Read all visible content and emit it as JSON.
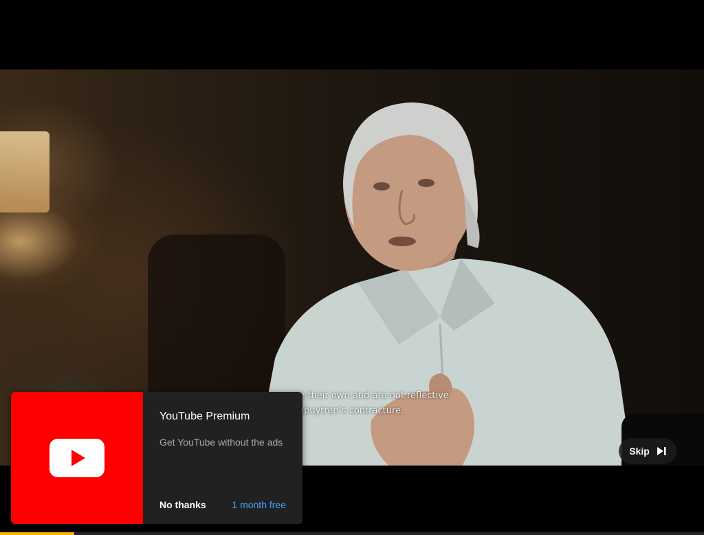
{
  "video": {
    "subtitle_lines": [
      "ences are their own and are not reflective",
      "e with Dupuytren’s contracture."
    ]
  },
  "ad": {
    "title": "YouTube Premium",
    "description": "Get YouTube without the ads",
    "decline_label": "No thanks",
    "accept_label": "1 month free",
    "logo_icon": "youtube-logo-icon",
    "thumb_color": "#ff0000",
    "accept_color": "#3ea6ff"
  },
  "skip": {
    "label": "Skip",
    "icon": "skip-next-icon"
  },
  "progress": {
    "fraction": 0.105,
    "color": "#f6b400"
  }
}
